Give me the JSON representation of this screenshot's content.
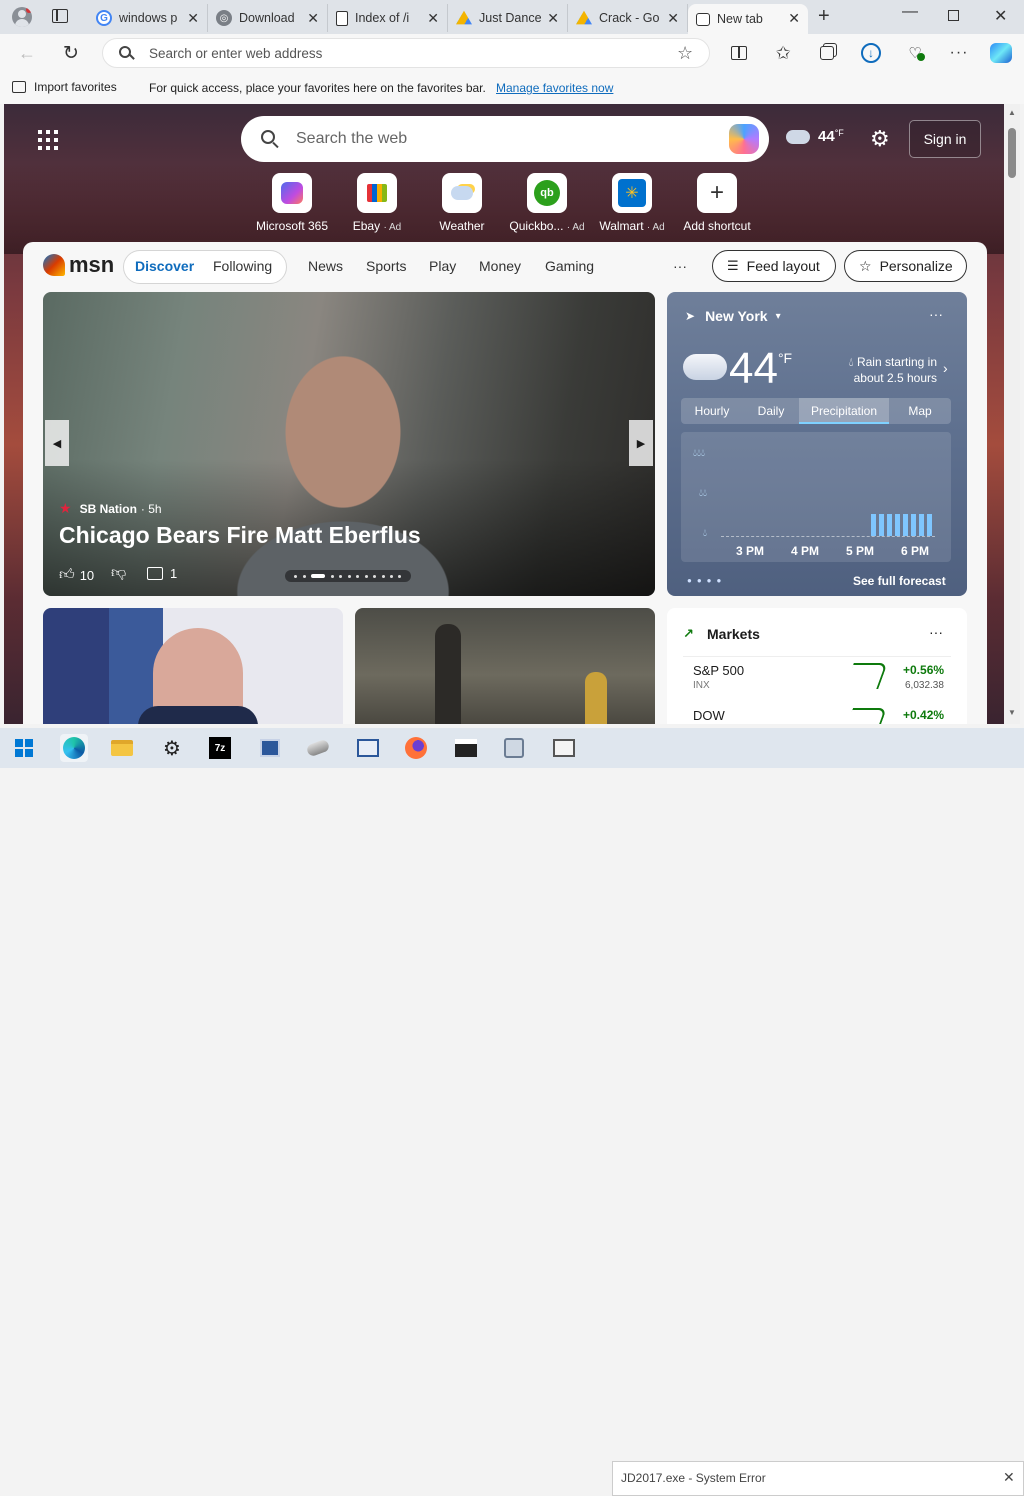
{
  "tabs": [
    {
      "title": "windows p",
      "icon": "google-icon"
    },
    {
      "title": "Download",
      "icon": "download-page-icon"
    },
    {
      "title": "Index of /i",
      "icon": "document-icon"
    },
    {
      "title": "Just Dance",
      "icon": "google-drive-icon"
    },
    {
      "title": "Crack - Go",
      "icon": "google-drive-icon"
    },
    {
      "title": "New tab",
      "icon": "new-tab-icon"
    }
  ],
  "address_bar": {
    "placeholder": "Search or enter web address"
  },
  "favorites_bar": {
    "import_label": "Import favorites",
    "message": "For quick access, place your favorites here on the favorites bar.",
    "manage_link": "Manage favorites now"
  },
  "page_search": {
    "placeholder": "Search the web"
  },
  "header_weather": {
    "temp": "44",
    "unit": "°F"
  },
  "sign_in": "Sign in",
  "shortcuts": [
    {
      "label": "Microsoft 365",
      "ad": ""
    },
    {
      "label": "Ebay",
      "ad": "· Ad"
    },
    {
      "label": "Weather",
      "ad": ""
    },
    {
      "label": "Quickbo...",
      "ad": "· Ad"
    },
    {
      "label": "Walmart",
      "ad": "· Ad"
    },
    {
      "label": "Add shortcut",
      "ad": ""
    }
  ],
  "msn": {
    "logo": "msn",
    "nav": [
      "Discover",
      "Following",
      "News",
      "Sports",
      "Play",
      "Money",
      "Gaming"
    ],
    "more": "···",
    "feed_layout": "Feed layout",
    "personalize": "Personalize"
  },
  "hero": {
    "source": "SB Nation",
    "age": "· 5h",
    "headline": "Chicago Bears Fire Matt Eberflus",
    "likes": "10",
    "comments": "1"
  },
  "weather": {
    "location": "New York",
    "temp": "44",
    "unit": "°F",
    "alert_line1": "Rain starting in",
    "alert_line2": "about 2.5 hours",
    "tabs": [
      "Hourly",
      "Daily",
      "Precipitation",
      "Map"
    ],
    "active_tab": "Precipitation",
    "times": [
      "3 PM",
      "4 PM",
      "5 PM",
      "6 PM"
    ],
    "forecast_link": "See full forecast"
  },
  "markets": {
    "title": "Markets",
    "rows": [
      {
        "name": "S&P 500",
        "ticker": "INX",
        "change": "+0.56%",
        "value": "6,032.38"
      },
      {
        "name": "DOW",
        "ticker": "",
        "change": "+0.42%",
        "value": ""
      }
    ]
  },
  "taskbar": {
    "error_window": "JD2017.exe - System Error"
  },
  "colors": {
    "accent": "#0f6cbd",
    "positive": "#0e7a0d"
  }
}
